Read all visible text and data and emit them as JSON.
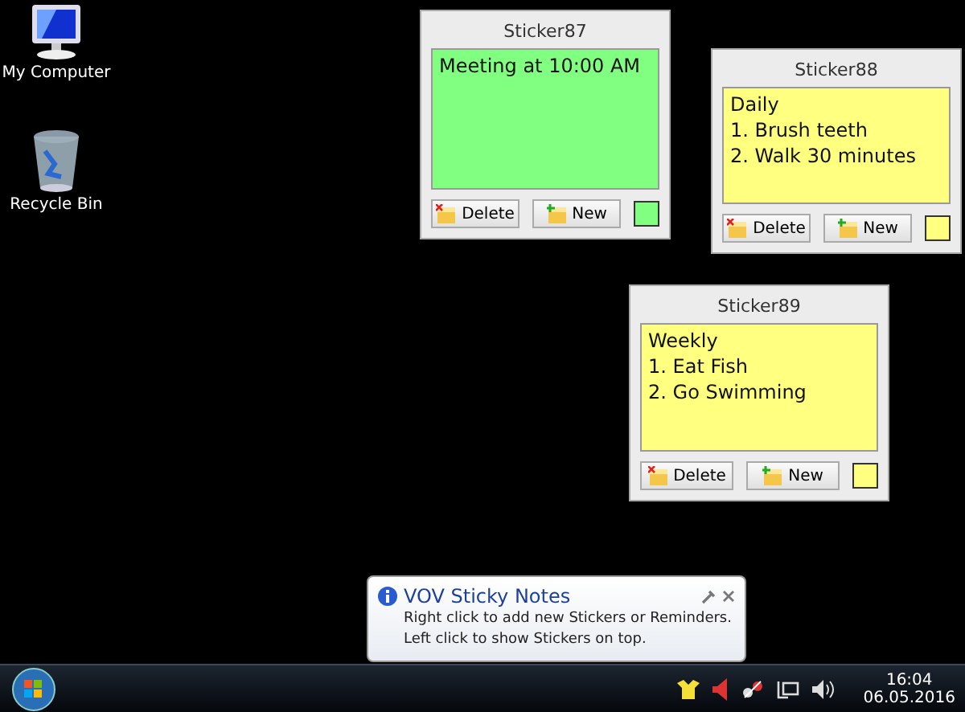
{
  "desktop_icons": [
    {
      "kind": "computer",
      "label": "My Computer"
    },
    {
      "kind": "recycle",
      "label": "Recycle Bin"
    }
  ],
  "stickers": [
    {
      "title": "Sticker87",
      "lines": [
        "Meeting at 10:00 AM"
      ],
      "color": "#80ff80",
      "buttons": [
        "Delete",
        "New"
      ]
    },
    {
      "title": "Sticker88",
      "lines": [
        "Daily",
        "1. Brush teeth",
        "2. Walk 30 minutes"
      ],
      "color": "#ffff80",
      "buttons": [
        "Delete",
        "New"
      ]
    },
    {
      "title": "Sticker89",
      "lines": [
        "Weekly",
        "1. Eat Fish",
        "2. Go Swimming"
      ],
      "color": "#ffff80",
      "buttons": [
        "Delete",
        "New"
      ]
    }
  ],
  "balloon": {
    "title": "VOV Sticky Notes",
    "lines": [
      "Right click to add new Stickers or Reminders.",
      "Left click to show Stickers on top."
    ]
  },
  "taskbar": {
    "time": "16:04",
    "date": "06.05.2016"
  }
}
